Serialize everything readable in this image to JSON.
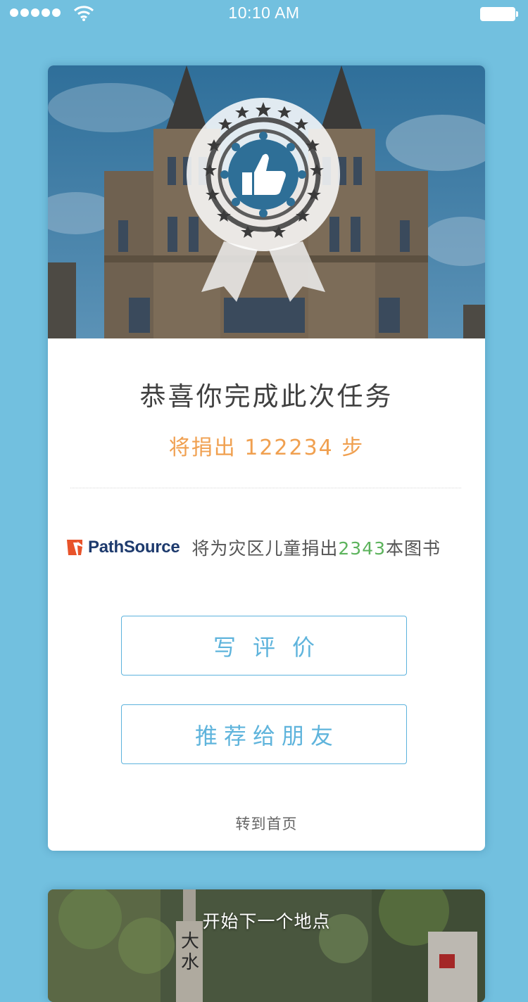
{
  "status_bar": {
    "time": "10:10 AM"
  },
  "result": {
    "title": "恭喜你完成此次任务",
    "steps_text": "将捐出 122234 步"
  },
  "sponsor": {
    "logo_path": "Path",
    "logo_o": "S",
    "logo_rest": "ource",
    "donation_prefix": "将为灾区儿童捐出",
    "book_count": "2343",
    "donation_suffix": "本图书",
    "brand_color": "#e8532a"
  },
  "actions": {
    "review_label": "写评价",
    "share_label": "推荐给朋友",
    "home_label": "转到首页"
  },
  "next": {
    "label": "开始下一个地点"
  },
  "colors": {
    "background": "#72c0df",
    "accent": "#5fb4dc",
    "steps": "#f0a050",
    "count": "#5cb35c"
  },
  "icons": [
    "signal-icon",
    "wifi-icon",
    "battery-icon",
    "medal-thumbs-up-icon",
    "pathsource-logo-icon"
  ]
}
